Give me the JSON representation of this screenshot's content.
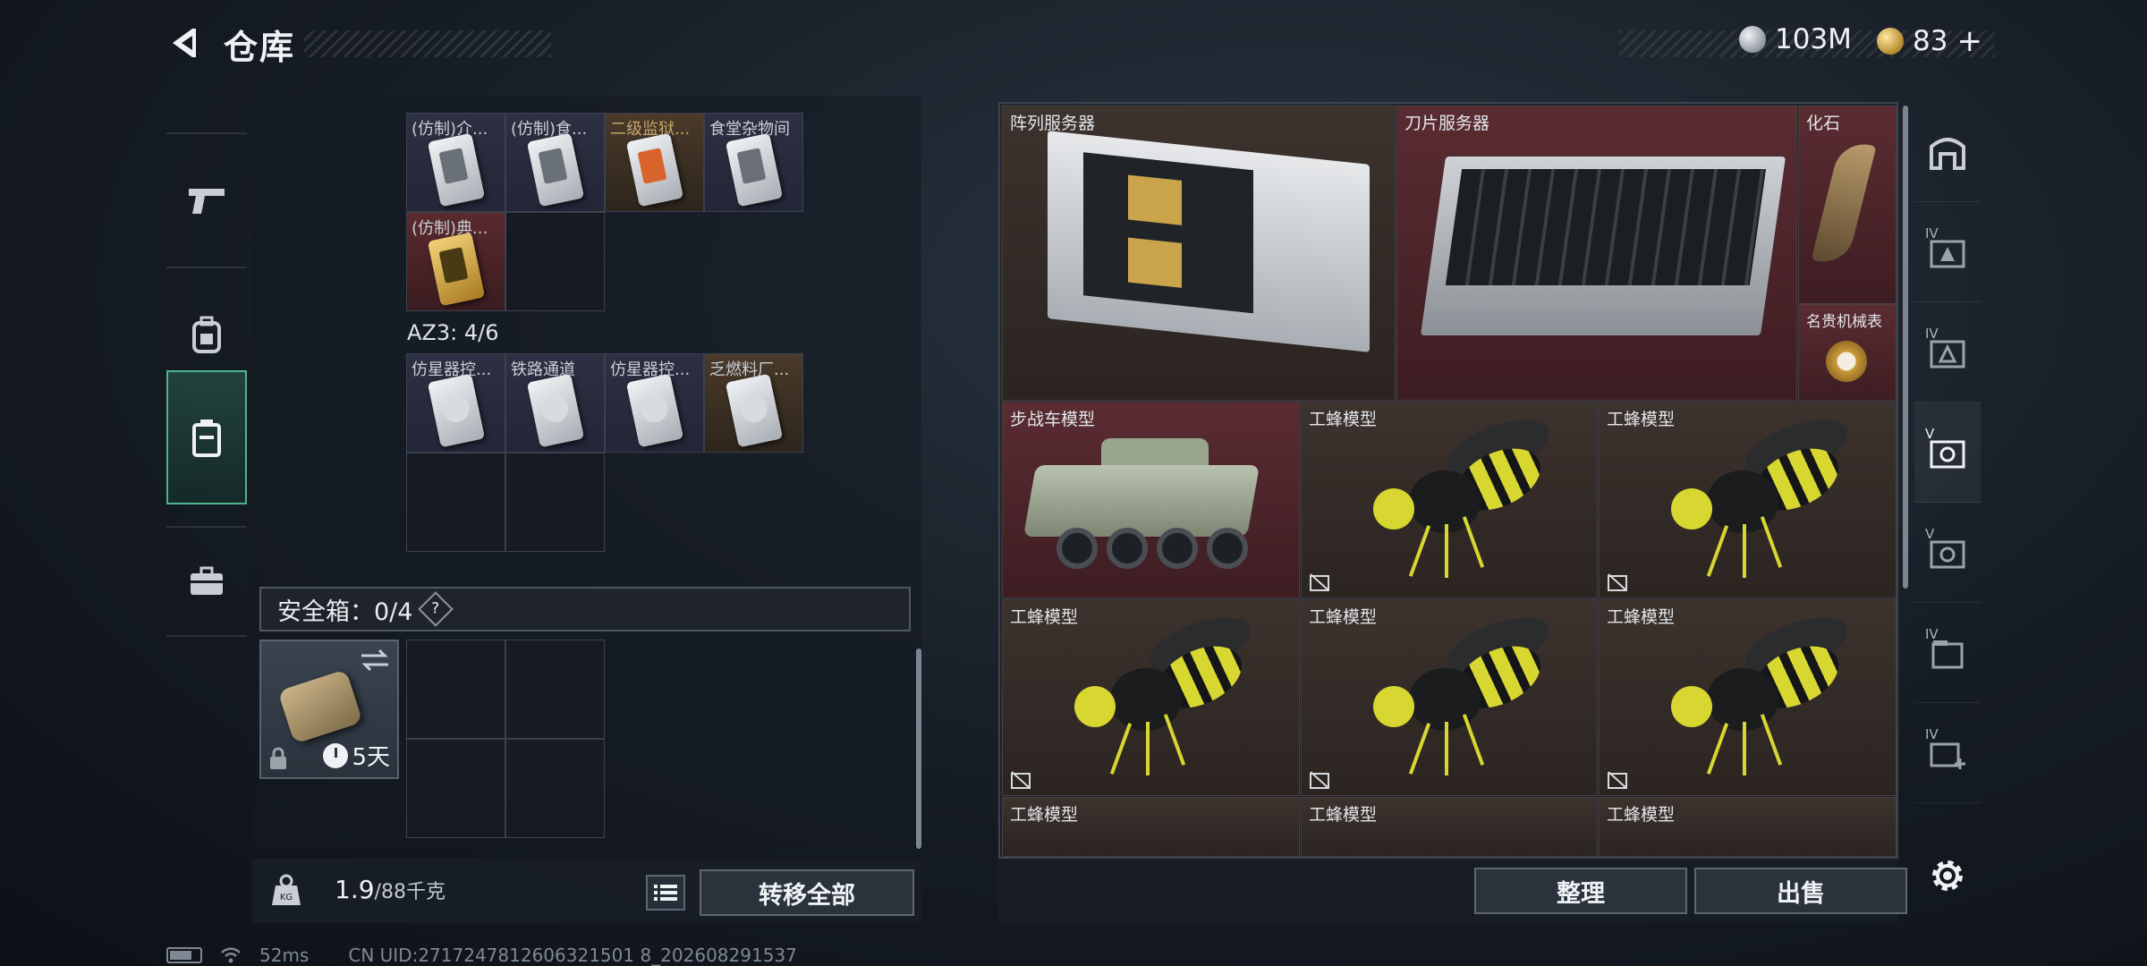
{
  "header": {
    "title": "仓库",
    "currencies": [
      {
        "icon": "silver-coin-icon",
        "value": "103M"
      },
      {
        "icon": "gold-coin-icon",
        "value": "83",
        "plus": "+"
      }
    ]
  },
  "left_tabs": [
    {
      "icon": "pistol-icon",
      "active": false
    },
    {
      "icon": "backpack-icon",
      "active": false
    },
    {
      "icon": "container-icon",
      "active": true
    },
    {
      "icon": "briefcase-icon",
      "active": false
    }
  ],
  "container1": {
    "items": [
      {
        "label": "(仿制)介...",
        "color": "purple"
      },
      {
        "label": "(仿制)食...",
        "color": "purple"
      },
      {
        "label": "二级监狱...",
        "color": "orange"
      },
      {
        "label": "食堂杂物间",
        "color": "purple"
      },
      {
        "label": "(仿制)典...",
        "color": "red"
      }
    ]
  },
  "container2": {
    "label": "AZ3: 4/6",
    "items": [
      {
        "label": "仿星器控...",
        "color": "purple"
      },
      {
        "label": "铁路通道",
        "color": "purple"
      },
      {
        "label": "仿星器控...",
        "color": "purple"
      },
      {
        "label": "乏燃料厂...",
        "color": "orange"
      }
    ]
  },
  "safe": {
    "label": "安全箱：0/4",
    "help": "?",
    "duration": "5天"
  },
  "weight": {
    "current": "1.9",
    "max": "/88千克"
  },
  "buttons": {
    "transfer_all": "转移全部",
    "sort": "整理",
    "sell": "出售"
  },
  "stash_items": [
    {
      "label": "阵列服务器",
      "color": "brown"
    },
    {
      "label": "刀片服务器",
      "color": "red"
    },
    {
      "label": "化石",
      "color": "red"
    },
    {
      "label": "名贵机械表",
      "color": "red"
    },
    {
      "label": "步战车模型",
      "color": "red"
    },
    {
      "label": "工蜂模型",
      "color": "brown"
    },
    {
      "label": "工蜂模型",
      "color": "brown"
    },
    {
      "label": "工蜂模型",
      "color": "brown"
    },
    {
      "label": "工蜂模型",
      "color": "brown"
    },
    {
      "label": "工蜂模型",
      "color": "brown"
    },
    {
      "label": "工蜂模型",
      "color": "brown"
    },
    {
      "label": "工蜂模型",
      "color": "brown"
    },
    {
      "label": "工蜂模型",
      "color": "brown"
    }
  ],
  "right_tabs": [
    {
      "icon": "stash-home-icon",
      "badge": ""
    },
    {
      "icon": "stash-tab-4-icon",
      "badge": "IV"
    },
    {
      "icon": "stash-tab-4b-icon",
      "badge": "IV"
    },
    {
      "icon": "stash-tab-5-icon",
      "badge": "V"
    },
    {
      "icon": "stash-tab-5b-icon",
      "badge": "V"
    },
    {
      "icon": "stash-tab-4c-icon",
      "badge": "IV"
    },
    {
      "icon": "stash-tab-add-icon",
      "badge": "IV"
    }
  ],
  "status": {
    "ping": "52ms",
    "uid": "CN UID:2717247812606321501 8_202608291537"
  }
}
